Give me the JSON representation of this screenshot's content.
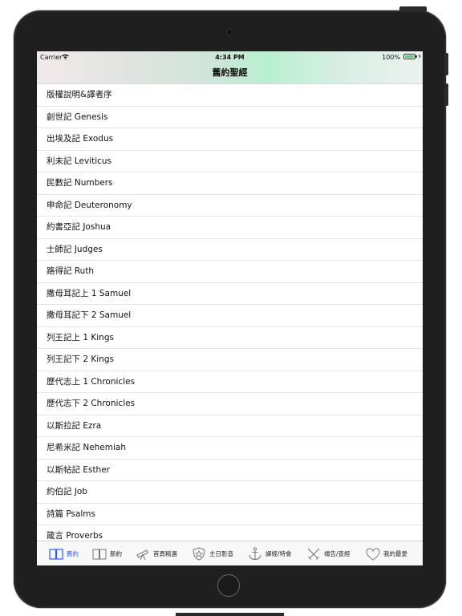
{
  "status_bar": {
    "carrier": "Carrier",
    "time": "4:34 PM",
    "battery": "100%"
  },
  "nav": {
    "title": "舊約聖經"
  },
  "books": [
    "版權說明&譯者序",
    "創世記 Genesis",
    "出埃及記 Exodus",
    "利未記 Leviticus",
    "民數記 Numbers",
    "申命記 Deuteronomy",
    "約書亞記 Joshua",
    "士師記 Judges",
    "路得記 Ruth",
    "撒母耳記上 1 Samuel",
    "撒母耳記下 2 Samuel",
    "列王記上 1 Kings",
    "列王記下 2 Kings",
    "歷代志上 1 Chronicles",
    "歷代志下 2 Chronicles",
    "以斯拉記 Ezra",
    "尼希米記 Nehemiah",
    "以斯帖記 Esther",
    "約伯記 Job",
    "詩篇 Psalms",
    "箴言 Proverbs"
  ],
  "tabs": [
    {
      "label": "舊約",
      "icon": "book-open-icon",
      "active": true
    },
    {
      "label": "新約",
      "icon": "book-icon"
    },
    {
      "label": "首頁精選",
      "icon": "telescope-icon"
    },
    {
      "label": "主日影音",
      "icon": "shield-star-icon"
    },
    {
      "label": "譯經/特會",
      "icon": "anchor-icon"
    },
    {
      "label": "禱告/查經",
      "icon": "crossed-swords-icon"
    },
    {
      "label": "我的最愛",
      "icon": "heart-icon"
    }
  ],
  "colors": {
    "accent": "#2f5cff",
    "battery": "#4cd964"
  }
}
